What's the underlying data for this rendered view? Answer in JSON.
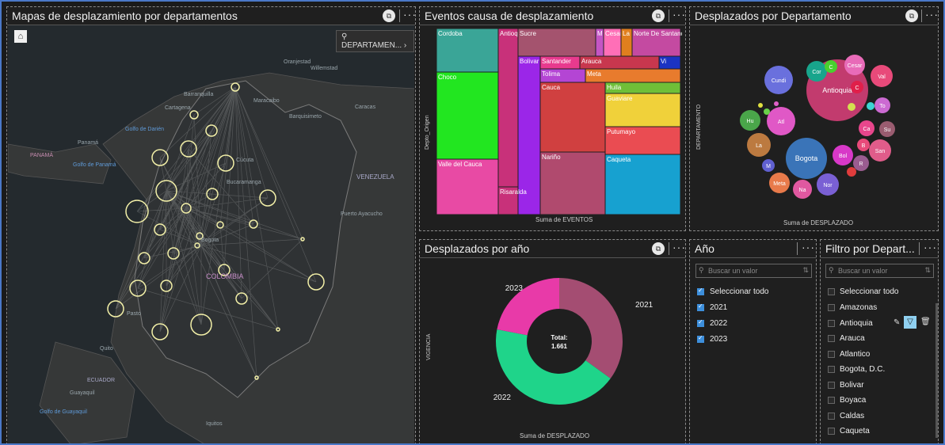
{
  "panels": {
    "map": {
      "title": "Mapas de desplazamiento por departamentos",
      "layer_chip": "DEPARTAMEN...",
      "home_icon": "home-icon"
    },
    "events": {
      "title": "Eventos causa de desplazamiento"
    },
    "dept_bubbles": {
      "title": "Desplazados por Departamento"
    },
    "by_year": {
      "title": "Desplazados por año"
    },
    "year_filter": {
      "title": "Año"
    },
    "dept_filter": {
      "title": "Filtro por Depart..."
    }
  },
  "map_labels": [
    "Oranjestad",
    "Willemstad",
    "Barranquilla",
    "Maracaibo",
    "Cartagena",
    "Caracas",
    "Barquisimeto",
    "Golfo de Darién",
    "Panamá",
    "PANAMÁ",
    "Golfo de Panamá",
    "Cúcuta",
    "Bucaramanga",
    "VENEZUELA",
    "Puerto Ayacucho",
    "Bogota",
    "COLOMBIA",
    "Pasto",
    "Quito",
    "ECUADOR",
    "Guayaquil",
    "Golfo de Guayaquil",
    "Iquitos"
  ],
  "chart_data": [
    {
      "type": "treemap",
      "title": "Eventos causa de desplazamiento",
      "ylabel": "Depto_Origen",
      "xlabel": "Suma de EVENTOS",
      "tiles": [
        "Cordoba",
        "Antioquia",
        "Sucre",
        "M",
        "Cesar",
        "La Gu",
        "Norte De Santander",
        "Choco",
        "Bolivar",
        "Santander",
        "Arauca",
        "Vi",
        "Tolima",
        "Meta",
        "Cauca",
        "Huila",
        "Guaviare",
        "Putumayo",
        "Nariño",
        "Caqueta",
        "Valle del Cauca",
        "Risaralda"
      ]
    },
    {
      "type": "bubble",
      "title": "Desplazados por Departamento",
      "ylabel": "DEPARTAMENTO",
      "xlabel": "Suma de DESPLAZADO",
      "bubbles": [
        "Antioquia",
        "Cundi",
        "Cor",
        "C",
        "Cesar",
        "Val",
        "C",
        "To",
        "Ca",
        "Su",
        "Hu",
        "Atl",
        "La",
        "Bogota",
        "Bol",
        "B",
        "San",
        "R",
        "M",
        "Meta",
        "Na",
        "Nor"
      ]
    },
    {
      "type": "pie",
      "title": "Desplazados por año",
      "ylabel": "VIGENCIA",
      "xlabel": "Suma de DESPLAZADO",
      "center_label": "Total:",
      "center_value": "1.661",
      "categories": [
        "2021",
        "2022",
        "2023"
      ],
      "values": [
        0.35,
        0.43,
        0.22
      ],
      "colors": [
        "#a44d72",
        "#1fd48a",
        "#e83aa8"
      ]
    }
  ],
  "year_filter": {
    "search_placeholder": "Buscar un valor",
    "select_all": "Seleccionar todo",
    "items": [
      "2021",
      "2022",
      "2023"
    ]
  },
  "dept_filter": {
    "search_placeholder": "Buscar un valor",
    "select_all": "Seleccionar todo",
    "items": [
      "Amazonas",
      "Antioquia",
      "Arauca",
      "Atlantico",
      "Bogota, D.C.",
      "Bolivar",
      "Boyaca",
      "Caldas",
      "Caqueta"
    ]
  }
}
